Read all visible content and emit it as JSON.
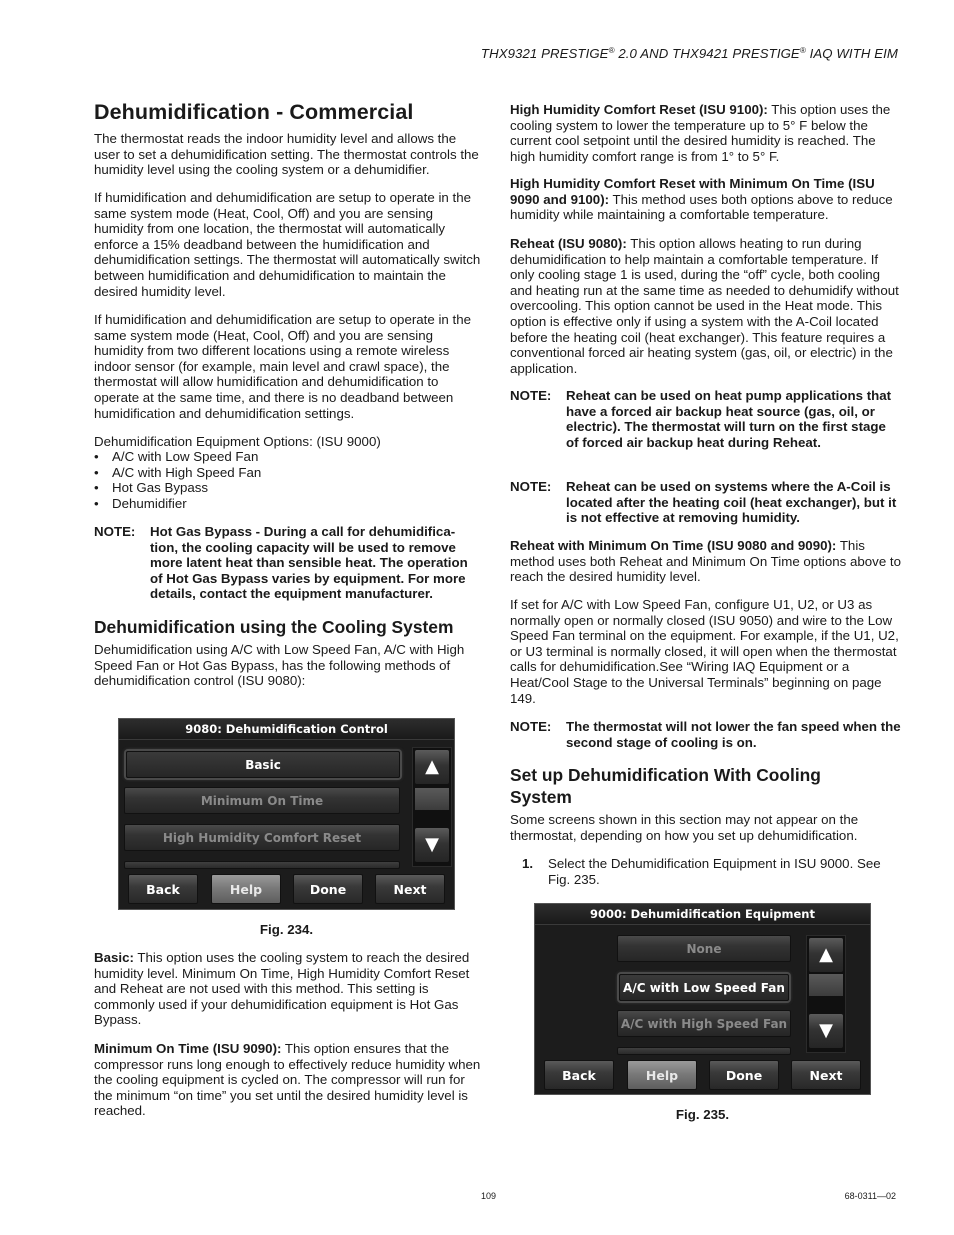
{
  "header": {
    "part1": "THX9321 PRESTIGE",
    "reg1": "®",
    "part2": " 2.0 AND THX9421 PRESTIGE",
    "reg2": "®",
    "part3": " IAQ WITH EIM"
  },
  "left": {
    "title": "Dehumidification - Commercial",
    "p1": "The thermostat reads the indoor humidity level and allows the user to set a dehumidification setting. The thermostat controls the humidity level using the cooling system or a dehumidifier.",
    "p2": "If humidification and dehumidification are setup to operate in the same system mode (Heat, Cool, Off) and you are sensing humidity from one location, the thermostat will automatically enforce a 15% deadband between the humidification and dehumidification settings. The thermostat will automatically switch between humidification and dehumidification to maintain the desired humidity level.",
    "p3": "If humidification and dehumidification are setup to operate in the same system mode (Heat, Cool, Off) and you are sensing humidity from two different locations using a remote wireless indoor sensor (for example, main level and crawl space), the thermostat will allow humidification and dehumidification to operate at the same time, and there is no deadband between humidification and dehumidification settings.",
    "options_intro": "Dehumidification Equipment Options: (ISU 9000)",
    "options": [
      "A/C with Low Speed Fan",
      "A/C with High Speed Fan",
      "Hot Gas Bypass",
      "Dehumidifier"
    ],
    "note_label": "NOTE:",
    "note1": "Hot Gas Bypass - During a call for dehumidifica-tion, the cooling capacity will be used to remove more latent heat than sensible heat. The operation of Hot Gas Bypass varies by equipment. For more details, contact the equipment manufacturer.",
    "subtitle": "Dehumidification using the Cooling System",
    "p4": "Dehumidification using A/C with Low Speed Fan, A/C with High Speed Fan or Hot Gas Bypass, has the following methods of dehumidification control (ISU 9080):",
    "fig234": {
      "title": "9080: Dehumidification Control",
      "options": [
        "Basic",
        "Minimum On Time",
        "High Humidity Comfort Reset"
      ],
      "selected": "Basic",
      "up_icon": "▲",
      "down_icon": "▼",
      "buttons": [
        "Back",
        "Help",
        "Done",
        "Next"
      ],
      "caption": "Fig. 234."
    },
    "basic_label": "Basic:",
    "basic_text": " This option uses the cooling system to reach the desired humidity level. Minimum On Time, High Humidity Comfort Reset and Reheat are not used with this method. This setting is commonly used if your dehumidification equipment is Hot Gas Bypass.",
    "mot_label": "Minimum On Time (ISU 9090):",
    "mot_text": " This option ensures that the compressor runs long enough to effectively reduce humidity when the cooling equipment is cycled on. The compressor will run for the minimum “on time” you set until the desired humidity level is reached."
  },
  "right": {
    "hhcr_label": "High Humidity Comfort Reset (ISU 9100):",
    "hhcr_text": " This option uses the cooling system to lower the temperature up to 5° F below the current cool setpoint until the desired humidity is reached. The high humidity comfort range is from 1° to 5° F.",
    "hhcr_mot_label": "High Humidity Comfort Reset with Minimum On Time (ISU 9090 and 9100):",
    "hhcr_mot_text": " This method uses both options above to reduce humidity while maintaining a comfortable temperature.",
    "reheat_label": "Reheat (ISU 9080):",
    "reheat_text": " This option allows heating to run during dehumidification to help maintain a comfortable temperature. If only cooling stage 1 is used, during the “off” cycle, both cooling and heating run at the same time as needed to dehumidify without overcooling. This option cannot be used in the Heat mode. This option is effective only if using a system with the A-Coil located before the heating coil (heat exchanger). This feature requires a conventional forced air heating system (gas, oil, or electric) in the application.",
    "note_label": "NOTE:",
    "note2": "Reheat can be used on heat pump applications that have a forced air backup heat source (gas, oil, or electric). The thermostat will turn on the first stage of forced air backup heat during Reheat.",
    "note3": "Reheat can be used on systems where the A-Coil is located after the heating coil (heat exchanger), but it is not effective at removing humidity.",
    "reheat_mot_label": "Reheat with Minimum On Time (ISU 9080 and 9090):",
    "reheat_mot_text": " This method uses both Reheat and Minimum On Time options above to reach the desired humidity level.",
    "p_lowspeed": "If set for A/C with Low Speed Fan, configure U1, U2, or U3 as normally open or normally closed (ISU 9050) and wire to the Low Speed Fan terminal on the equipment. For example, if the U1, U2, or U3 terminal is normally closed, it will open when the thermostat calls for dehumidification.See “Wiring IAQ Equipment or a Heat/Cool Stage to the Universal Terminals” beginning on page 149.",
    "note4": "The thermostat will not lower the fan speed when the second stage of cooling is on.",
    "setup_title": "Set up Dehumidification With Cooling System",
    "setup_text": "Some screens shown in this section may not appear on the thermostat, depending on how you set up dehumidification.",
    "step_num": "1.",
    "step_text": "Select the Dehumidification Equipment in ISU 9000. See Fig. 235.",
    "fig235": {
      "title": "9000: Dehumidification Equipment",
      "options": [
        "None",
        "A/C with Low Speed Fan",
        "A/C with High Speed Fan"
      ],
      "selected": "A/C with Low Speed Fan",
      "up_icon": "▲",
      "down_icon": "▼",
      "buttons": [
        "Back",
        "Help",
        "Done",
        "Next"
      ],
      "caption": "Fig. 235."
    }
  },
  "footer": {
    "page_number": "109",
    "doc_number": "68-0311—02"
  }
}
